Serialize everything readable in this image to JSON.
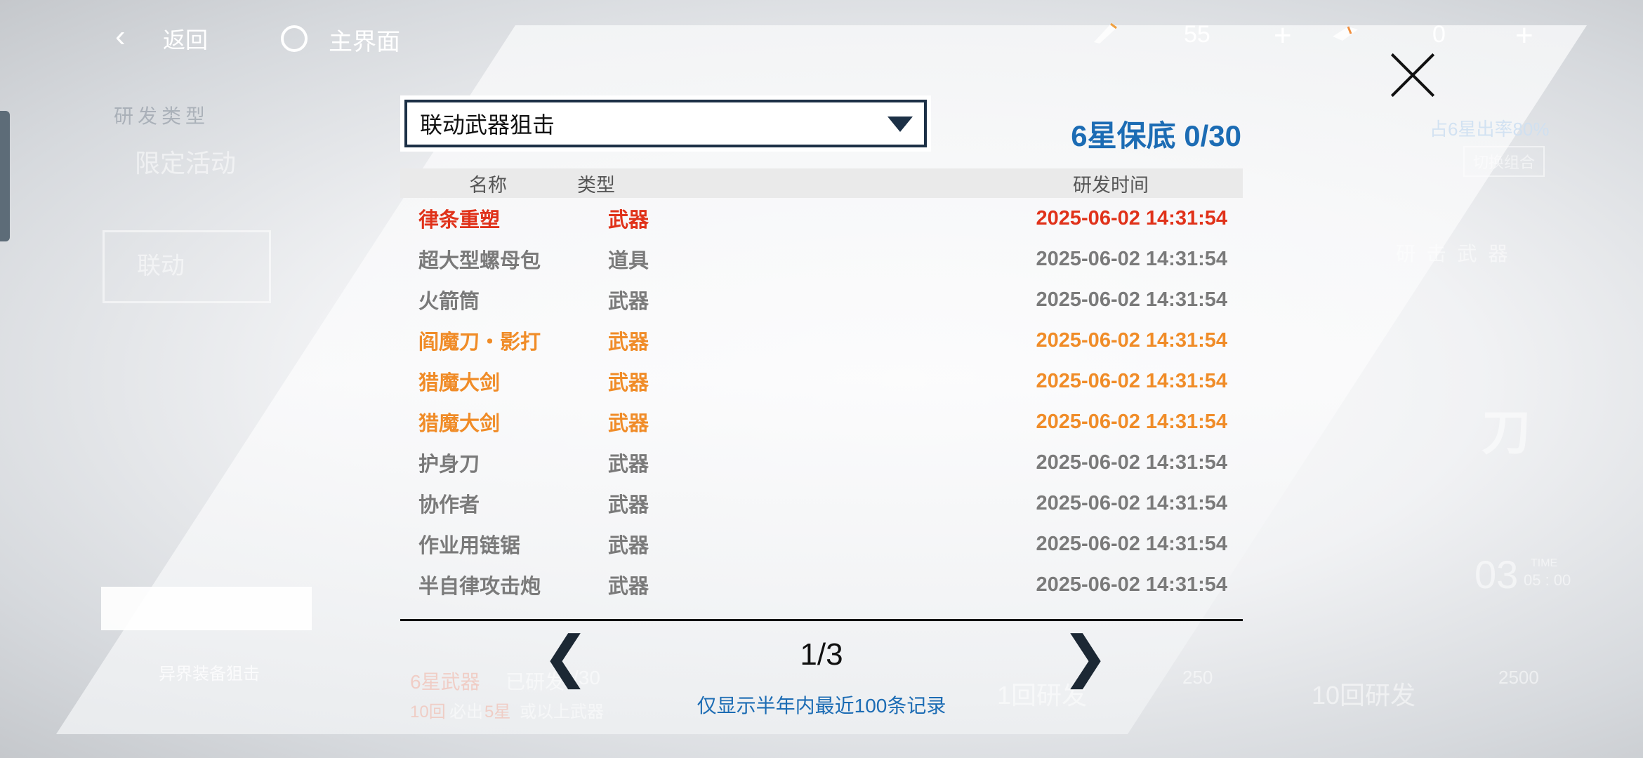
{
  "topbar": {
    "back_label": "返回",
    "home_label": "主界面",
    "resource1_count": "55",
    "resource2_count": "0",
    "plus_label": "+"
  },
  "background_ghost": {
    "dev_type": "研发类型",
    "limited_event": "限定活动",
    "collab": "联动",
    "rate_up": "占6星出率80%",
    "switch_combo": "切换组合",
    "category": "研 击 武 器",
    "blade": "刀",
    "timer_num": "03",
    "timer_label": "TIME",
    "timer_value": "05 : 00",
    "other_banner": "异界装备狙击",
    "six_star_weapon": "6星武器",
    "researched": "已研发",
    "count_tail": "/30",
    "guarantee_10": "10回",
    "guarantee_mid": "必出",
    "guarantee_5": "5星",
    "guarantee_end": "或以上武器",
    "single_pull": "1回研发",
    "single_cost": "250",
    "ten_pull": "10回研发",
    "ten_cost": "2500"
  },
  "dialog": {
    "selected_pool": "联动武器狙击",
    "pity_text": "6星保底 0/30",
    "columns": {
      "name": "名称",
      "type": "类型",
      "time": "研发时间"
    },
    "colors": {
      "red": "#e0321a",
      "orange": "#f08c28",
      "gray": "#7a7a7a"
    },
    "rows": [
      {
        "name": "律条重塑",
        "type": "武器",
        "time": "2025-06-02 14:31:54",
        "rarity": "red"
      },
      {
        "name": "超大型螺母包",
        "type": "道具",
        "time": "2025-06-02 14:31:54",
        "rarity": "gray"
      },
      {
        "name": "火箭筒",
        "type": "武器",
        "time": "2025-06-02 14:31:54",
        "rarity": "gray"
      },
      {
        "name": "阎魔刀・影打",
        "type": "武器",
        "time": "2025-06-02 14:31:54",
        "rarity": "orange"
      },
      {
        "name": "猎魔大剑",
        "type": "武器",
        "time": "2025-06-02 14:31:54",
        "rarity": "orange"
      },
      {
        "name": "猎魔大剑",
        "type": "武器",
        "time": "2025-06-02 14:31:54",
        "rarity": "orange"
      },
      {
        "name": "护身刀",
        "type": "武器",
        "time": "2025-06-02 14:31:54",
        "rarity": "gray"
      },
      {
        "name": "协作者",
        "type": "武器",
        "time": "2025-06-02 14:31:54",
        "rarity": "gray"
      },
      {
        "name": "作业用链锯",
        "type": "武器",
        "time": "2025-06-02 14:31:54",
        "rarity": "gray"
      },
      {
        "name": "半自律攻击炮",
        "type": "武器",
        "time": "2025-06-02 14:31:54",
        "rarity": "gray"
      }
    ],
    "page": "1/3",
    "note": "仅显示半年内最近100条记录"
  }
}
